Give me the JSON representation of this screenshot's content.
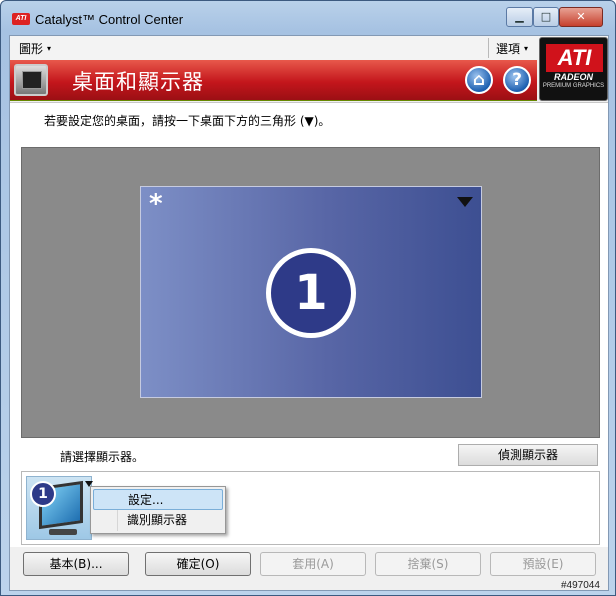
{
  "window": {
    "title": "Catalyst™ Control Center",
    "icon": "ati-small-icon",
    "minimize": "▁",
    "maximize": "□",
    "close": "✕"
  },
  "menubar": {
    "left_menu": "圖形",
    "right_menu": "選項",
    "caret": "▾"
  },
  "banner": {
    "title": "桌面和顯示器",
    "home_symbol": "⌂",
    "help_symbol": "?",
    "logo_text": "ATI",
    "logo_sub": "RADEON",
    "logo_premium": "PREMIUM GRAPHICS"
  },
  "content": {
    "instruction": "若要設定您的桌面，請按一下桌面下方的三角形 (▼)。",
    "monitor": {
      "primary_marker": "*",
      "number": "1"
    },
    "select_label": "請選擇顯示器。",
    "detect_button": "偵測顯示器",
    "thumbnail_number": "1",
    "context_menu": [
      "設定...",
      "識別顯示器"
    ]
  },
  "buttons": {
    "basic": "基本(B)...",
    "ok": "確定(O)",
    "apply": "套用(A)",
    "discard": "捨棄(S)",
    "defaults": "預設(E)"
  },
  "watermark": "#497044",
  "colors": {
    "banner_red": "#c4161c",
    "monitor_blue": "#5866a6",
    "number_circle": "#2e3a88",
    "menu_highlight": "#cde4f7"
  }
}
